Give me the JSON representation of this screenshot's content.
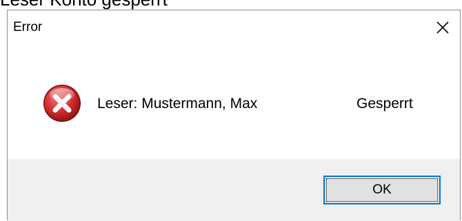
{
  "background_caption": "Leser  Konto gesperrt",
  "dialog": {
    "title": "Error",
    "message": "Leser: Mustermann, Max",
    "status": "Gesperrt",
    "ok_label": "OK",
    "icon": "error-icon"
  },
  "colors": {
    "focus_border": "#0078d7",
    "footer_bg": "#f0f0f0",
    "button_bg": "#e1e1e1",
    "icon_red": "#d32f2f"
  }
}
